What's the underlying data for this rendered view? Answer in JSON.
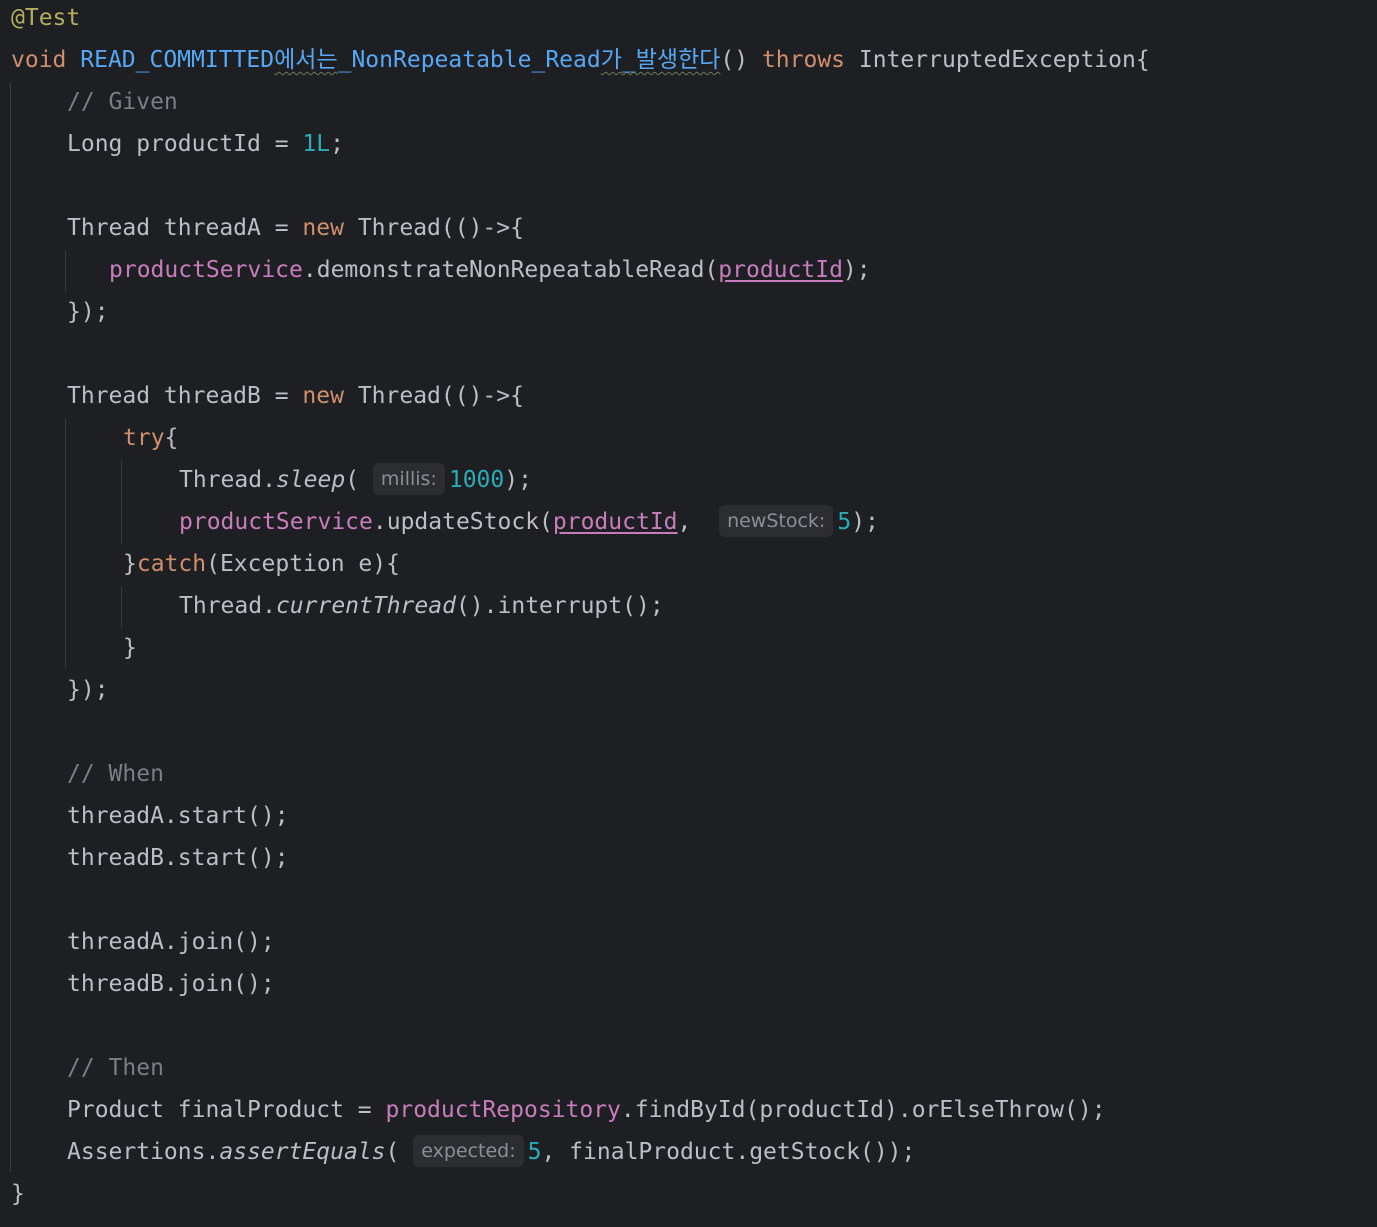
{
  "code": {
    "annotation": "@Test",
    "method_return": "void",
    "method_name_part1": "READ_COMMITTED",
    "method_name_part2": "에서는",
    "method_name_part3": "_NonRepeatable_Read",
    "method_name_part4": "가_발생한다",
    "method_parens": "()",
    "throws_kw": "throws",
    "exception_type": "InterruptedException{",
    "comment_given": "// Given",
    "long_decl": "Long productId = ",
    "long_value": "1L",
    "semicolon": ";",
    "threadA_decl": "Thread threadA = ",
    "new_kw": "new",
    "thread_lambda": "Thread(()->{",
    "product_service": "productService",
    "demo_call": ".demonstrateNonRepeatableRead(",
    "product_id_param": "productId",
    "close_call": ");",
    "close_lambda": "});",
    "threadB_decl": "Thread threadB = ",
    "try_kw": "try",
    "open_brace": "{",
    "thread_sleep_prefix": "Thread.",
    "sleep_method": "sleep",
    "open_paren": "(",
    "hint_millis": "millis:",
    "sleep_value": "1000",
    "update_call": ".updateStock(",
    "comma": ", ",
    "hint_new_stock": "newStock:",
    "stock_value": "5",
    "catch_close_brace": "}",
    "catch_kw": "catch",
    "catch_args": "(Exception e){",
    "current_thread_method": "currentThread",
    "interrupt_call": "().interrupt();",
    "close_brace": "}",
    "comment_when": "// When",
    "threadA_start": "threadA.start();",
    "threadB_start": "threadB.start();",
    "threadA_join": "threadA.join();",
    "threadB_join": "threadB.join();",
    "comment_then": "// Then",
    "final_product_decl": "Product finalProduct = ",
    "product_repository": "productRepository",
    "find_by_id_call": ".findById(productId).orElseThrow();",
    "assertions_prefix": "Assertions.",
    "assert_equals_method": "assertEquals",
    "hint_expected": "expected:",
    "expected_value": "5",
    "get_stock_call": ", finalProduct.getStock());",
    "method_close": "}"
  },
  "colors": {
    "background": "#1e1f22",
    "default_text": "#bcbec4",
    "keyword": "#cf8e6d",
    "method_declaration": "#56a8f5",
    "annotation": "#b3ae60",
    "comment": "#7a7e85",
    "number": "#2aacb8",
    "field": "#c77dbb",
    "inlay_hint_bg": "#2b2d30"
  }
}
